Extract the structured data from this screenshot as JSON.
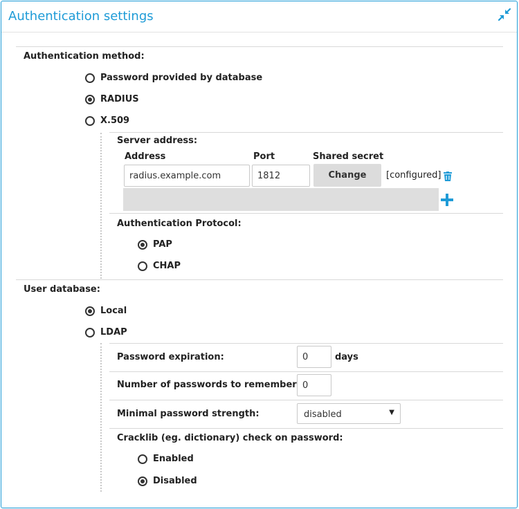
{
  "header": {
    "title": "Authentication settings",
    "collapse_icon": "collapse-arrows-icon"
  },
  "auth_method": {
    "label": "Authentication method:",
    "options": [
      {
        "label": "Password provided by database",
        "selected": false
      },
      {
        "label": "RADIUS",
        "selected": true
      },
      {
        "label": "X.509",
        "selected": false
      }
    ]
  },
  "radius": {
    "server_address_label": "Server address:",
    "col_address": "Address",
    "col_port": "Port",
    "col_secret": "Shared secret",
    "address_value": "radius.example.com",
    "port_value": "1812",
    "change_button": "Change",
    "configured_text": "[configured]",
    "delete_icon": "trash-icon",
    "add_icon": "plus-icon",
    "protocol_label": "Authentication Protocol:",
    "protocol_options": [
      {
        "label": "PAP",
        "selected": true
      },
      {
        "label": "CHAP",
        "selected": false
      }
    ]
  },
  "user_db": {
    "label": "User database:",
    "options": [
      {
        "label": "Local",
        "selected": true
      },
      {
        "label": "LDAP",
        "selected": false
      }
    ]
  },
  "local": {
    "pw_expiration_label": "Password expiration:",
    "pw_expiration_value": "0",
    "pw_expiration_unit": "days",
    "pw_remember_label": "Number of passwords to remember:",
    "pw_remember_value": "0",
    "min_strength_label": "Minimal password strength:",
    "min_strength_value": "disabled",
    "cracklib_label": "Cracklib (eg. dictionary) check on password:",
    "cracklib_options": [
      {
        "label": "Enabled",
        "selected": false
      },
      {
        "label": "Disabled",
        "selected": true
      }
    ]
  },
  "colors": {
    "accent": "#1e9bd7"
  }
}
